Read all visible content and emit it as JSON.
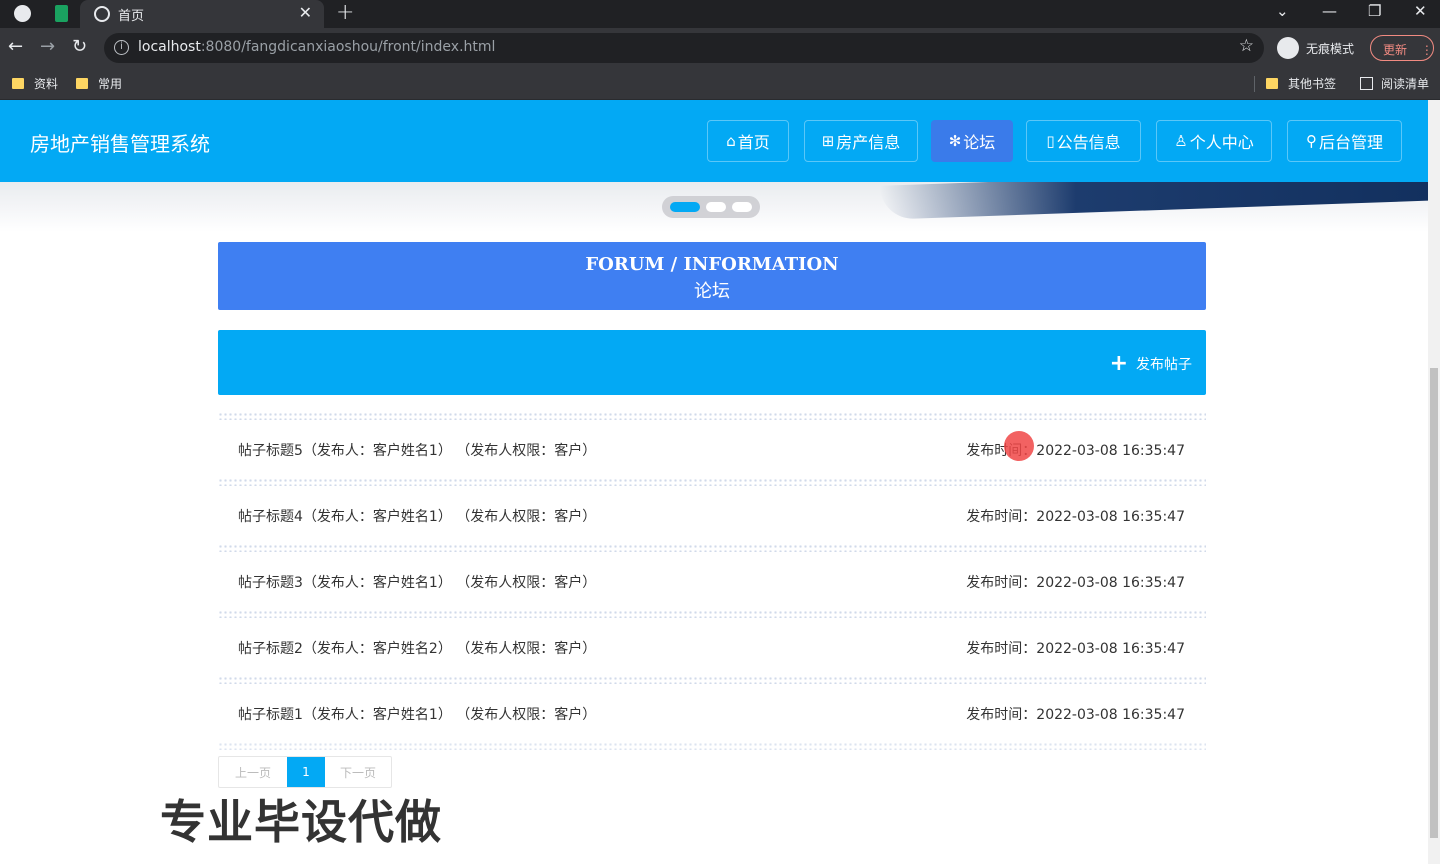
{
  "browser": {
    "tab_title": "首页",
    "url_host": "localhost",
    "url_rest": ":8080/fangdicanxiaoshou/front/index.html",
    "incognito_label": "无痕模式",
    "update_label": "更新",
    "bookmarks": [
      "资料",
      "常用"
    ],
    "other_bookmarks": "其他书签",
    "reading_list": "阅读清单"
  },
  "site": {
    "title": "房地产销售管理系统",
    "nav": [
      {
        "icon": "⌂",
        "label": "首页",
        "active": false
      },
      {
        "icon": "⊞",
        "label": "房产信息",
        "active": false
      },
      {
        "icon": "✻",
        "label": "论坛",
        "active": true
      },
      {
        "icon": "▯",
        "label": "公告信息",
        "active": false
      },
      {
        "icon": "♙",
        "label": "个人中心",
        "active": false
      },
      {
        "icon": "⚲",
        "label": "后台管理",
        "active": false
      }
    ]
  },
  "section": {
    "title_en": "FORUM / INFORMATION",
    "title_cn": "论坛"
  },
  "actions": {
    "publish_label": "发布帖子"
  },
  "posts": [
    {
      "title": "帖子标题5（发布人：客户姓名1） （发布人权限：客户）",
      "time": "发布时间：2022-03-08 16:35:47"
    },
    {
      "title": "帖子标题4（发布人：客户姓名1） （发布人权限：客户）",
      "time": "发布时间：2022-03-08 16:35:47"
    },
    {
      "title": "帖子标题3（发布人：客户姓名1） （发布人权限：客户）",
      "time": "发布时间：2022-03-08 16:35:47"
    },
    {
      "title": "帖子标题2（发布人：客户姓名2） （发布人权限：客户）",
      "time": "发布时间：2022-03-08 16:35:47"
    },
    {
      "title": "帖子标题1（发布人：客户姓名1） （发布人权限：客户）",
      "time": "发布时间：2022-03-08 16:35:47"
    }
  ],
  "pagination": {
    "prev": "上一页",
    "current": "1",
    "next": "下一页"
  },
  "watermark": "专业毕设代做",
  "colors": {
    "header": "#03a9f4",
    "section_head": "#3f7ff2",
    "active_nav": "#3a7bea"
  }
}
